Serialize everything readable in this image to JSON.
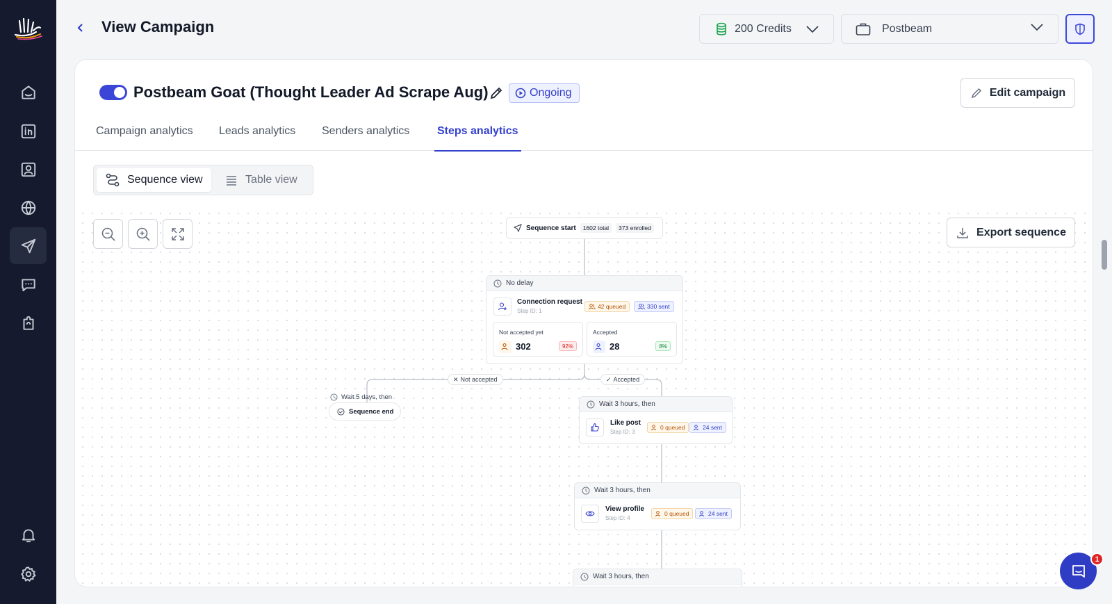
{
  "header": {
    "title": "View Campaign",
    "credits_label": "200 Credits",
    "workspace_label": "Postbeam"
  },
  "campaign": {
    "name": "Postbeam Goat (Thought Leader Ad Scrape Aug)",
    "status": "Ongoing",
    "active": true,
    "edit_label": "Edit campaign"
  },
  "tabs": [
    {
      "label": "Campaign analytics"
    },
    {
      "label": "Leads analytics"
    },
    {
      "label": "Senders analytics"
    },
    {
      "label": "Steps analytics",
      "active": true
    }
  ],
  "view_switch": {
    "sequence_label": "Sequence view",
    "table_label": "Table view",
    "selected": "Sequence view"
  },
  "canvas": {
    "export_label": "Export sequence"
  },
  "sequence": {
    "start": {
      "label": "Sequence start",
      "total": "1602 total",
      "enrolled": "373 enrolled"
    },
    "step1": {
      "delay": "No delay",
      "title": "Connection request",
      "step_id": "Step ID: 1",
      "queued": "42 queued",
      "sent": "330 sent",
      "not_accepted_label": "Not accepted yet",
      "not_accepted_value": "302",
      "not_accepted_pct": "92%",
      "accepted_label": "Accepted",
      "accepted_value": "28",
      "accepted_pct": "8%"
    },
    "branch_not_accepted": "Not accepted",
    "branch_accepted": "Accepted",
    "end_wait": "Wait 5 days, then",
    "end_label": "Sequence end",
    "step3": {
      "wait": "Wait 3 hours, then",
      "title": "Like post",
      "step_id": "Step ID: 3",
      "queued": "0 queued",
      "sent": "24 sent"
    },
    "step4": {
      "wait": "Wait 3 hours, then",
      "title": "View profile",
      "step_id": "Step ID: 4",
      "queued": "0 queued",
      "sent": "24 sent"
    },
    "step5": {
      "wait": "Wait 3 hours, then"
    }
  },
  "chat": {
    "badge": "1"
  },
  "colors": {
    "sidebar": "#151a2e",
    "accent": "#3b46d6",
    "queued": "#b45309",
    "sent": "#3440c8",
    "danger": "#e02424",
    "success": "#15803d"
  }
}
